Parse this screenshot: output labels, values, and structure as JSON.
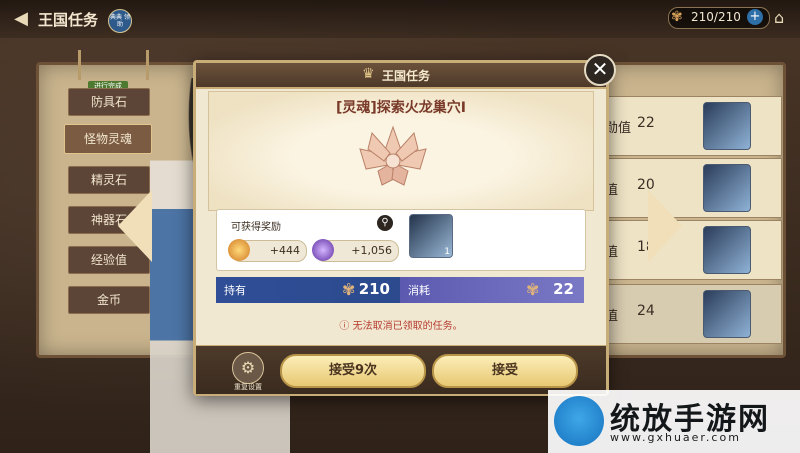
{
  "header": {
    "title": "王国任务",
    "guide_badge": "典典 领助",
    "stamina": "210/210"
  },
  "sidebar": {
    "in_progress_tag": "进行完成",
    "items": [
      {
        "label": "防具石"
      },
      {
        "label": "怪物灵魂"
      },
      {
        "label": "精灵石"
      },
      {
        "label": "神器石"
      },
      {
        "label": "经验值"
      },
      {
        "label": "金币"
      }
    ]
  },
  "right_list": {
    "rows": [
      {
        "label": "勋值",
        "value": "22"
      },
      {
        "label": "值",
        "value": "20"
      },
      {
        "label": "值",
        "value": "18"
      },
      {
        "label": "值",
        "value": "24"
      }
    ]
  },
  "modal": {
    "title": "王国任务",
    "quest_name": "[灵魂]探索火龙巢穴Ⅰ",
    "reward_label": "可获得奖励",
    "rewards": [
      {
        "value": "+444",
        "icon": "gold-coin-icon"
      },
      {
        "value": "+1,056",
        "icon": "exp-orb-icon"
      }
    ],
    "reward_item_count": "1",
    "own_label": "持有",
    "own_value": "210",
    "cost_label": "消耗",
    "cost_value": "22",
    "notice": "ⓘ 无法取消已领取的任务。",
    "reset_label": "重复设置",
    "accept_multi": "接受9次",
    "accept": "接受"
  },
  "watermark": {
    "text": "统放手游网",
    "url": "www.gxhuaer.com"
  },
  "colors": {
    "accent_gold": "#e8c873",
    "own_bar": "#2f4e97",
    "cost_bar": "#6f6dbd",
    "notice_red": "#b53b2f"
  }
}
